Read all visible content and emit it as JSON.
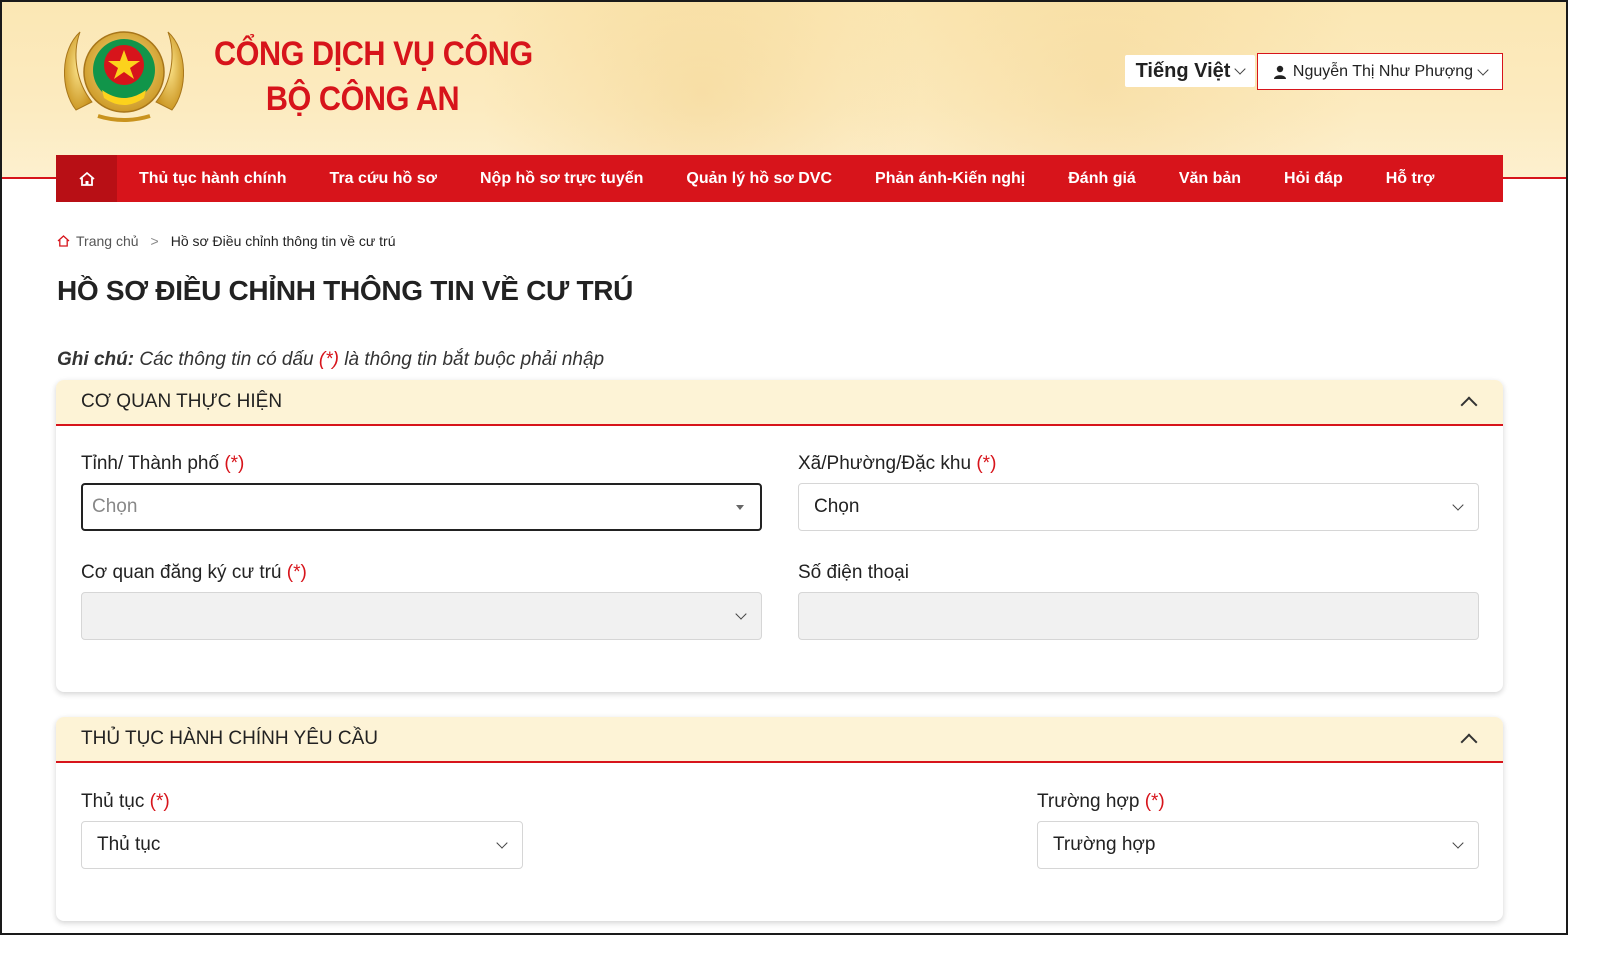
{
  "brand": {
    "line1": "CỔNG DỊCH VỤ CÔNG",
    "line2": "BỘ CÔNG AN"
  },
  "header": {
    "language": "Tiếng Việt",
    "user_name": "Nguyễn Thị Như Phượng"
  },
  "nav": {
    "items": [
      "Thủ tục hành chính",
      "Tra cứu hồ sơ",
      "Nộp hồ sơ trực tuyến",
      "Quản lý hồ sơ DVC",
      "Phản ánh-Kiến nghị",
      "Đánh giá",
      "Văn bản",
      "Hỏi đáp",
      "Hỗ trợ"
    ]
  },
  "breadcrumb": {
    "home": "Trang chủ",
    "separator": ">",
    "current": "Hồ sơ Điều chỉnh thông tin về cư trú"
  },
  "page": {
    "title": "HỒ SƠ ĐIỀU CHỈNH THÔNG TIN VỀ CƯ TRÚ"
  },
  "note": {
    "label": "Ghi chú:",
    "text_before": " Các thông tin có dấu ",
    "required_mark": "(*)",
    "text_after": " là thông tin bắt buộc phải nhập"
  },
  "section1": {
    "title": "CƠ QUAN THỰC HIỆN",
    "province": {
      "label": "Tỉnh/ Thành phố ",
      "req": "(*)",
      "placeholder": "Chọn"
    },
    "ward": {
      "label": "Xã/Phường/Đặc khu ",
      "req": "(*)",
      "value": "Chọn"
    },
    "agency": {
      "label": "Cơ quan đăng ký cư trú ",
      "req": "(*)",
      "value": ""
    },
    "phone": {
      "label": "Số điện thoại",
      "value": ""
    }
  },
  "section2": {
    "title": "THỦ TỤC HÀNH CHÍNH YÊU CẦU",
    "procedure": {
      "label": "Thủ tục ",
      "req": "(*)",
      "value": "Thủ tục"
    },
    "case": {
      "label": "Trường hợp ",
      "req": "(*)",
      "value": "Trường hợp"
    }
  },
  "colors": {
    "accent": "#d7141b",
    "header_bg": "#fbe7b4",
    "card_head_bg": "#fdf3d6"
  },
  "icons": {
    "home": "home-icon",
    "user": "user-icon",
    "collapse": "chevron-up-icon"
  }
}
